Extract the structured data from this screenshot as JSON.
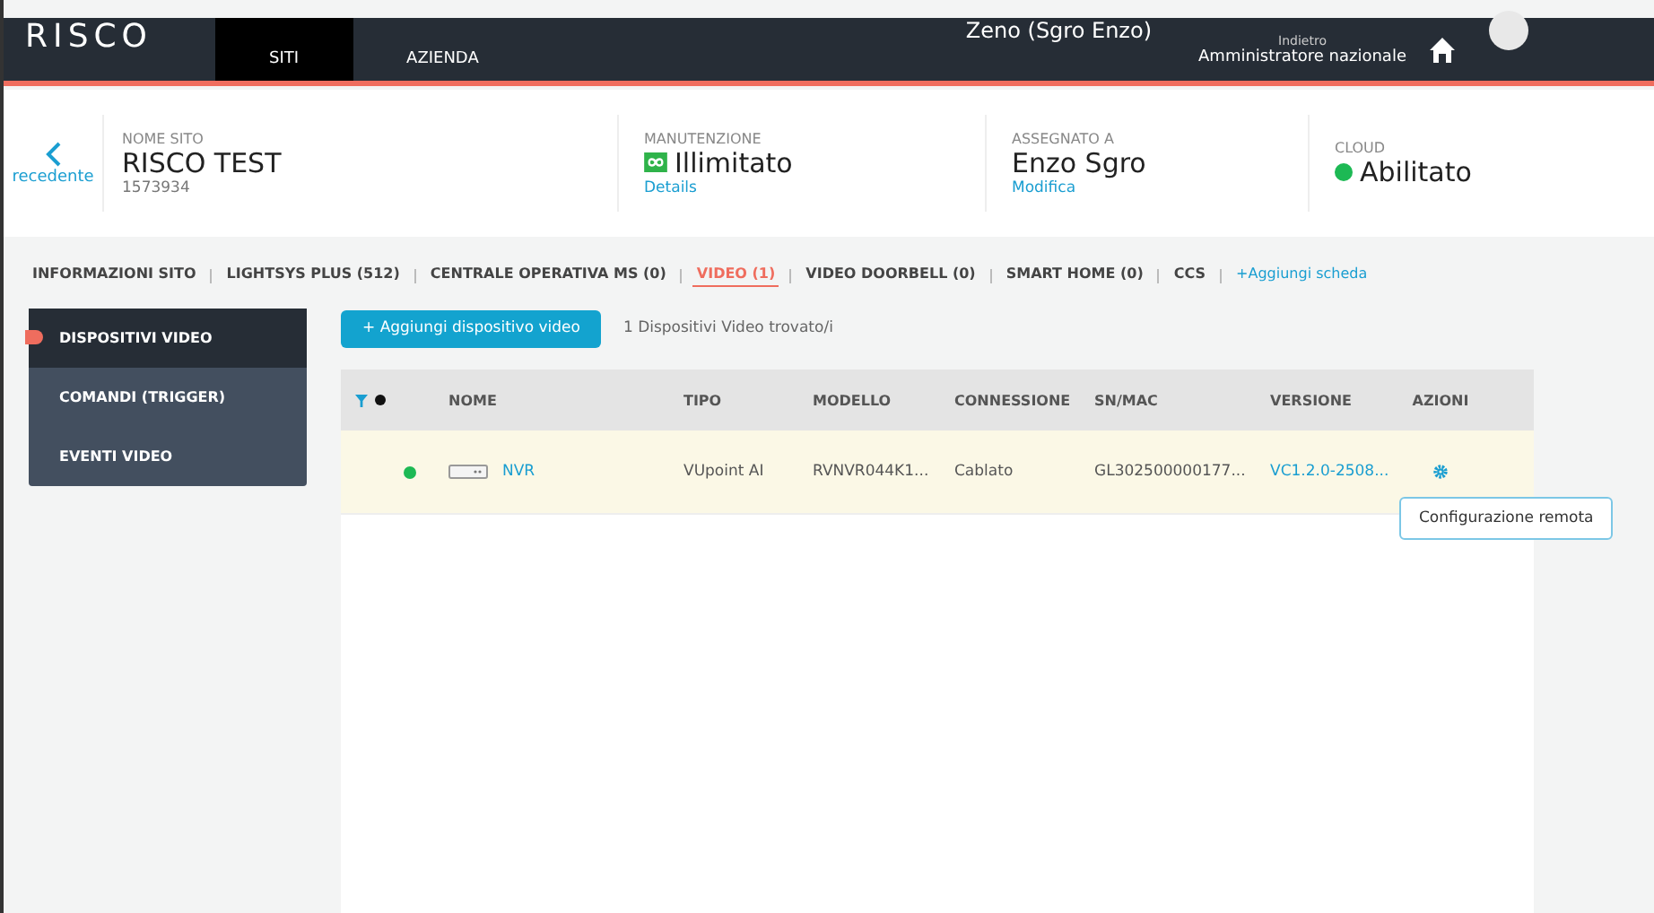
{
  "header": {
    "logo": "RISCO",
    "nav": [
      {
        "label": "SITI",
        "selected": true
      },
      {
        "label": "AZIENDA",
        "selected": false
      }
    ],
    "user": "Zeno (Sgro Enzo)",
    "back_label": "Indietro",
    "role": "Amministratore nazionale"
  },
  "site": {
    "back": "recedente",
    "fields": [
      {
        "kind": "name",
        "label": "NOME SITO",
        "value": "RISCO TEST",
        "sub": "1573934"
      },
      {
        "kind": "maintenance",
        "label": "MANUTENZIONE",
        "value": "Illimitato",
        "sub": "Details"
      },
      {
        "kind": "assigned",
        "label": "ASSEGNATO A",
        "value": "Enzo Sgro",
        "sub": "Modifica"
      },
      {
        "kind": "cloud",
        "label": "CLOUD",
        "value": "Abilitato",
        "color": "#1db954"
      }
    ]
  },
  "tabs": [
    {
      "label": "INFORMAZIONI SITO",
      "selected": false
    },
    {
      "label": "LIGHTSYS PLUS (512)",
      "selected": false
    },
    {
      "label": "CENTRALE OPERATIVA MS (0)",
      "selected": false
    },
    {
      "label": "VIDEO (1)",
      "selected": true
    },
    {
      "label": "VIDEO DOORBELL (0)",
      "selected": false
    },
    {
      "label": "SMART HOME (0)",
      "selected": false
    },
    {
      "label": "CCS",
      "selected": false
    }
  ],
  "add_tab": "+Aggiungi scheda",
  "sidebar": {
    "items": [
      {
        "label": "DISPOSITIVI VIDEO",
        "selected": true
      },
      {
        "label": "COMANDI (TRIGGER)",
        "selected": false
      },
      {
        "label": "EVENTI VIDEO",
        "selected": false
      }
    ]
  },
  "toolbar": {
    "add_button": "+ Aggiungi dispositivo video",
    "count": "1 Dispositivi Video trovato/i"
  },
  "table": {
    "columns": [
      "NOME",
      "TIPO",
      "MODELLO",
      "CONNESSIONE",
      "SN/MAC",
      "VERSIONE",
      "AZIONI"
    ],
    "rows": [
      {
        "color": "#1db954",
        "name": "NVR",
        "type": "VUpoint AI",
        "model": "RVNVR044K1...",
        "connection": "Cablato",
        "sn": "GL302500000177...",
        "version": "VC1.2.0-2508..."
      }
    ]
  },
  "tooltip": "Configurazione remota"
}
